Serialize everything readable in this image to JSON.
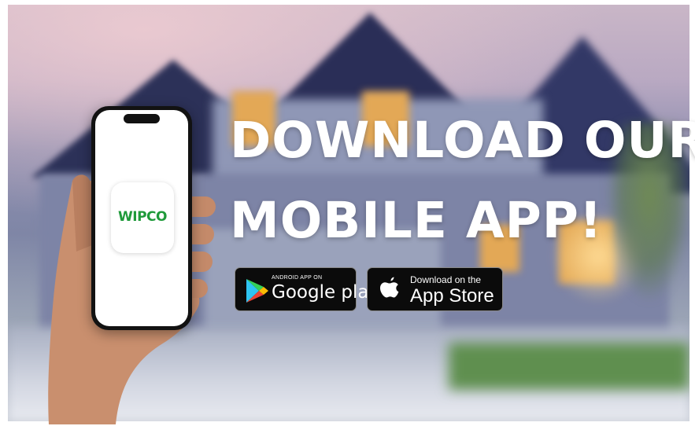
{
  "banner": {
    "headline_line1": "DOWNLOAD OUR",
    "headline_line2": "MOBILE APP!"
  },
  "google_play": {
    "small_label": "ANDROID APP ON",
    "big_label": "Google play",
    "icon": "google-play-icon"
  },
  "app_store": {
    "small_label": "Download on the",
    "big_label": "App Store",
    "icon": "apple-icon"
  },
  "phone": {
    "app_name": "WIPCO",
    "brand_color": "#1f9a3a"
  }
}
